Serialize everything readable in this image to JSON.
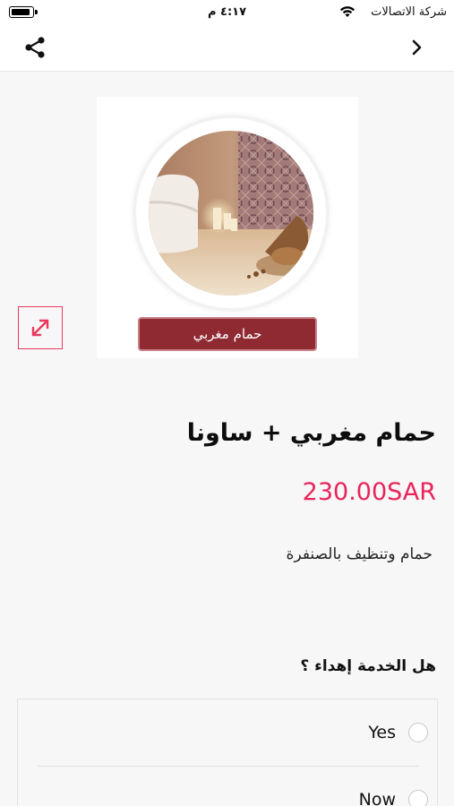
{
  "status_bar": {
    "carrier": "شركة الاتصالات",
    "time": "٤:١٧ م",
    "icons": [
      "battery-icon",
      "wifi-icon"
    ]
  },
  "nav": {
    "icons": [
      "share-icon",
      "chevron-right-icon"
    ]
  },
  "product": {
    "image_label": "حمام مغربي",
    "title": "حمام مغربي + ساونا",
    "price": "230.00SAR",
    "description": "حمام وتنظيف بالصنفرة"
  },
  "gift_question": {
    "label": "هل الخدمة إهداء ؟",
    "options": [
      {
        "label": "Yes",
        "selected": false
      },
      {
        "label": "Now",
        "selected": false
      }
    ]
  },
  "colors": {
    "accent": "#e8245a",
    "label_bg": "#8f2a33",
    "background": "#f7f7f7"
  }
}
